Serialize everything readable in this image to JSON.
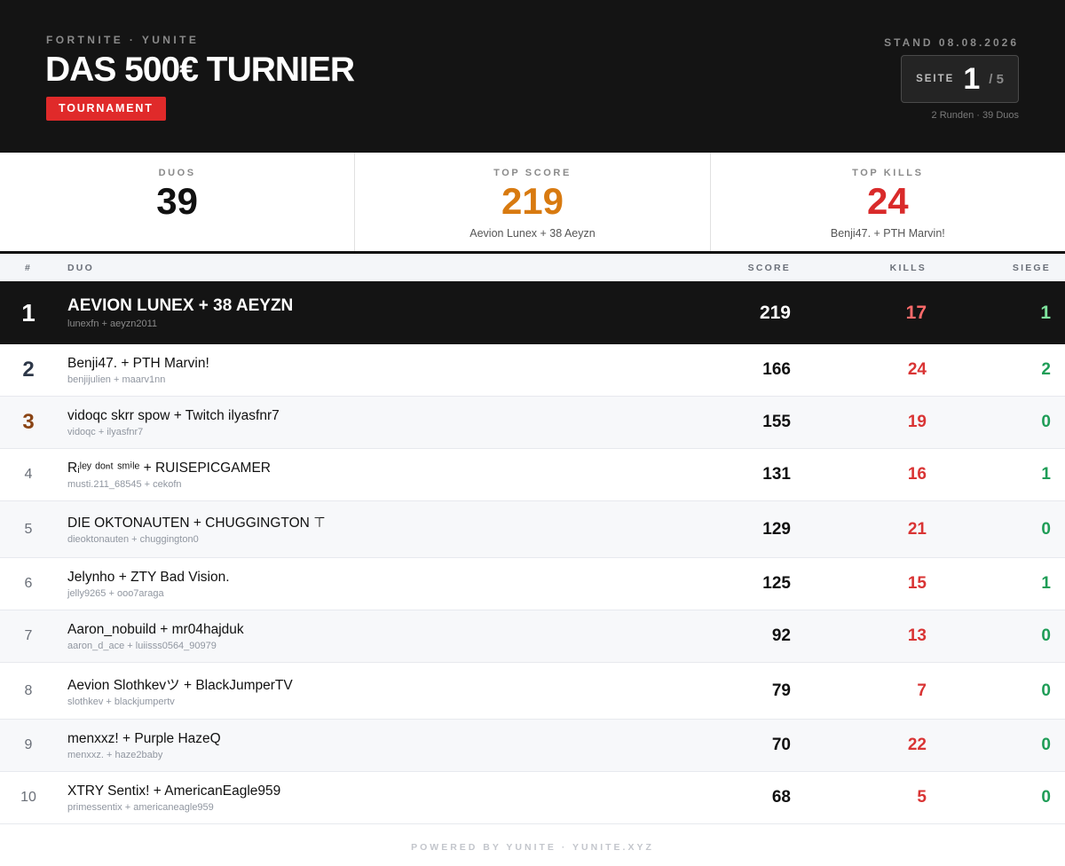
{
  "header": {
    "eyebrow": "FORTNITE · YUNITE",
    "title": "DAS 500€ TURNIER",
    "badge": "TOURNAMENT",
    "stand": "STAND 08.08.2026",
    "page_label": "SEITE",
    "page_current": "1",
    "page_total": "/ 5",
    "meta": "2 Runden · 39 Duos"
  },
  "stats": [
    {
      "label": "DUOS",
      "value": "39",
      "sub": "",
      "color": "#111111"
    },
    {
      "label": "TOP SCORE",
      "value": "219",
      "sub": "Aevion Lunex + 38 Aeyzn",
      "color": "#d87a10"
    },
    {
      "label": "TOP KILLS",
      "value": "24",
      "sub": "Benji47. + PTH Marvin!",
      "color": "#d92a2a"
    }
  ],
  "table": {
    "headers": {
      "rank": "#",
      "duo": "DUO",
      "score": "SCORE",
      "kills": "KILLS",
      "wins": "SIEGE"
    },
    "rows": [
      {
        "rank": "1",
        "name": "AEVION LUNEX + 38 AEYZN",
        "accounts": "lunexfn + aeyzn2011",
        "score": "219",
        "kills": "17",
        "wins": "1"
      },
      {
        "rank": "2",
        "name": "Benji47. + PTH Marvin!",
        "accounts": "benjijulien + maarv1nn",
        "score": "166",
        "kills": "24",
        "wins": "2"
      },
      {
        "rank": "3",
        "name": "vidoqc skrr spow + Twitch ilyasfnr7",
        "accounts": "vidoqc + ilyasfnr7",
        "score": "155",
        "kills": "19",
        "wins": "0"
      },
      {
        "rank": "4",
        "name": "Rᵢˡᵉʸ ᵈᵒⁿᵗ ˢᵐⁱˡᵉ + RUISEPICGAMER",
        "accounts": "musti.211_68545 + cekofn",
        "score": "131",
        "kills": "16",
        "wins": "1"
      },
      {
        "rank": "5",
        "name": "DIE OKTONAUTEN + CHUGGINGTON ⊤̄",
        "accounts": "dieoktonauten + chuggington0",
        "score": "129",
        "kills": "21",
        "wins": "0"
      },
      {
        "rank": "6",
        "name": "Jelynho + ZTY Bad Vision.",
        "accounts": "jelly9265 + ooo7araga",
        "score": "125",
        "kills": "15",
        "wins": "1"
      },
      {
        "rank": "7",
        "name": "Aaron_nobuild + mr04hajduk",
        "accounts": "aaron_d_ace + luiisss0564_90979",
        "score": "92",
        "kills": "13",
        "wins": "0"
      },
      {
        "rank": "8",
        "name": "Aevion Slothkevツ + BlackJumperTV",
        "accounts": "slothkev + blackjumpertv",
        "score": "79",
        "kills": "7",
        "wins": "0"
      },
      {
        "rank": "9",
        "name": "menxxz! + Purple HazeQ",
        "accounts": "menxxz. + haze2baby",
        "score": "70",
        "kills": "22",
        "wins": "0"
      },
      {
        "rank": "10",
        "name": "XTRY Sentix! + AmericanEagle959",
        "accounts": "primessentix + americaneagle959",
        "score": "68",
        "kills": "5",
        "wins": "0"
      }
    ]
  },
  "footer": "POWERED BY YUNITE · YUNITE.XYZ"
}
